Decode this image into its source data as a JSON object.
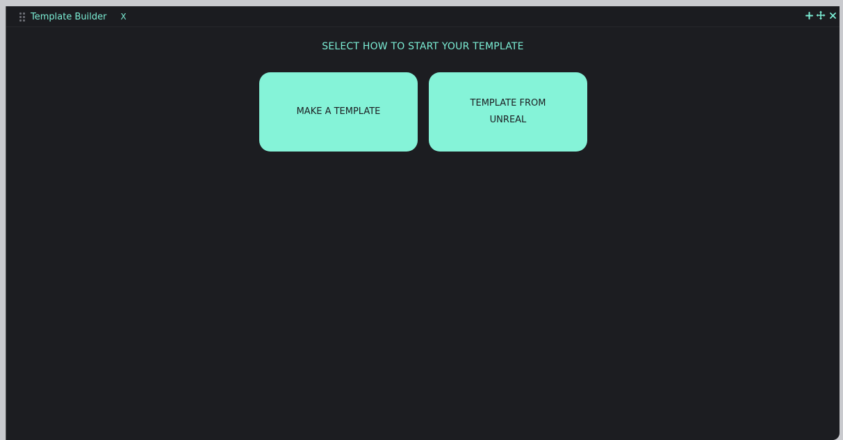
{
  "tab": {
    "title": "Template Builder",
    "close_label": "X"
  },
  "window_controls": {
    "add_icon": "plus-icon",
    "move_icon": "move-icon",
    "close_icon": "close-icon"
  },
  "main": {
    "prompt": "SELECT HOW TO START YOUR TEMPLATE",
    "options": [
      {
        "label": "MAKE A TEMPLATE"
      },
      {
        "label": "TEMPLATE FROM\nUNREAL"
      }
    ]
  },
  "colors": {
    "accent": "#7cefd6",
    "button_bg": "#85f3d8",
    "panel_bg": "#1c1d21"
  }
}
